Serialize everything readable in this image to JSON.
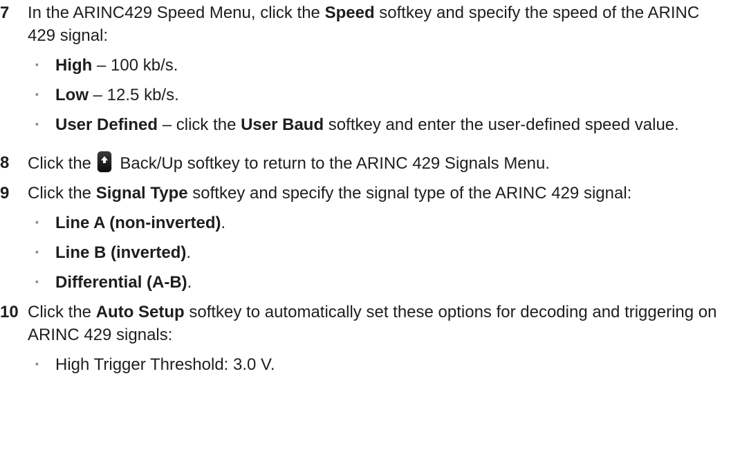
{
  "steps": [
    {
      "num": "7",
      "pre": "In the ARINC429 Speed Menu, click the ",
      "bold": "Speed",
      "post": " softkey and specify the speed of the ARINC 429 signal:",
      "bullets": [
        {
          "bold": "High",
          "text": " – 100 kb/s."
        },
        {
          "bold": "Low",
          "text": " – 12.5 kb/s."
        },
        {
          "bold": "User Defined",
          "text": " – click the ",
          "bold2": "User Baud",
          "text2": " softkey and enter the user-defined speed value."
        }
      ]
    },
    {
      "num": "8",
      "pre": "Click the ",
      "icon": "back-up-softkey-icon",
      "post": " Back/Up softkey to return to the ARINC 429 Signals Menu."
    },
    {
      "num": "9",
      "pre": "Click the ",
      "bold": "Signal Type",
      "post": " softkey and specify the signal type of the ARINC 429 signal:",
      "bullets": [
        {
          "bold": "Line A (non-inverted)",
          "text": "."
        },
        {
          "bold": "Line B (inverted)",
          "text": "."
        },
        {
          "bold": "Differential (A-B)",
          "text": "."
        }
      ]
    },
    {
      "num": "10",
      "pre": "Click the ",
      "bold": "Auto Setup",
      "post": " softkey to automatically set these options for decoding and triggering on ARINC 429 signals:",
      "bullets": [
        {
          "text": "High Trigger Threshold: 3.0 V."
        }
      ]
    }
  ]
}
